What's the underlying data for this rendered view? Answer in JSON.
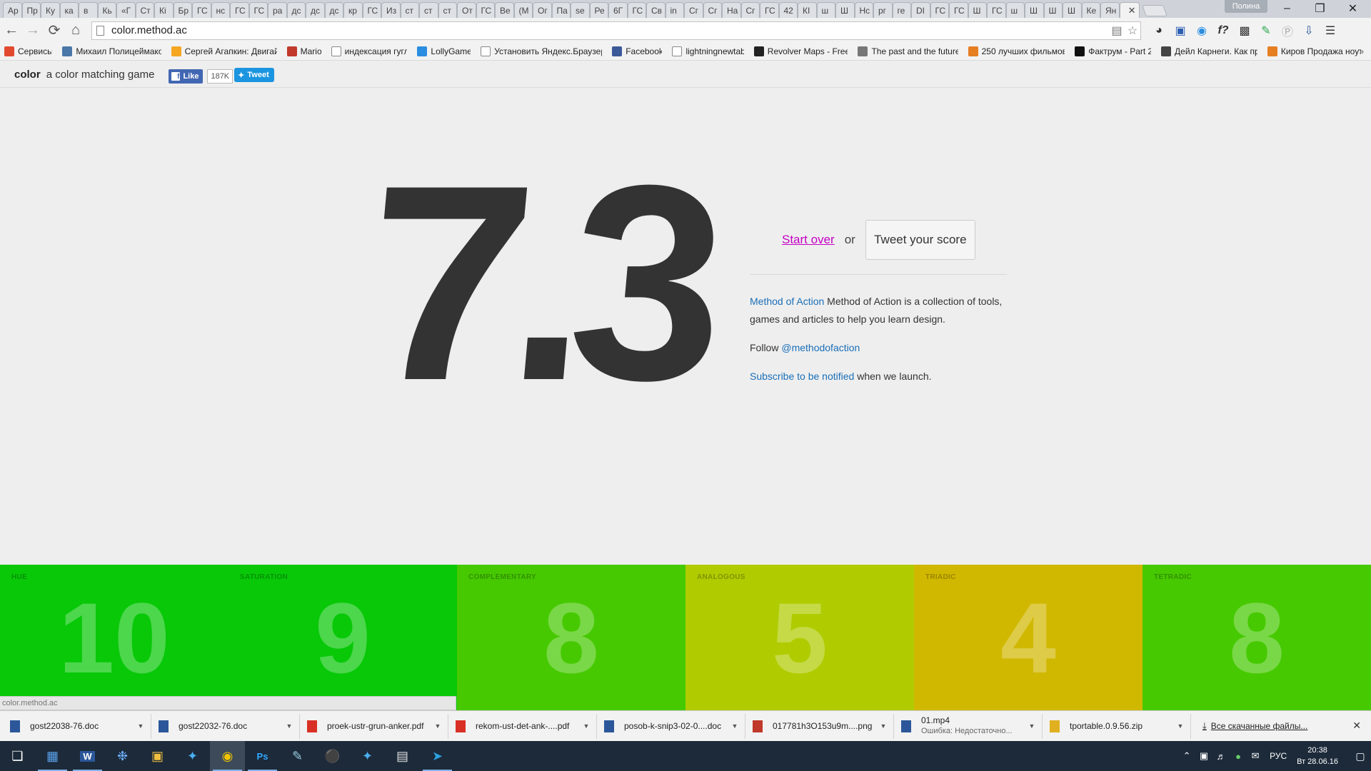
{
  "browser": {
    "tabs": [
      "Ар",
      "Пр",
      "Ку",
      "ка",
      "в",
      "Кь",
      "«Г",
      "Ст",
      "Кі",
      "Бр",
      "ГС",
      "нс",
      "ГС",
      "ГС",
      "ра",
      "дс",
      "дс",
      "дс",
      "кр",
      "ГС",
      "Из",
      "ст",
      "ст",
      "ст",
      "От",
      "ГС",
      "Ве",
      "(М",
      "Ог",
      "Па",
      "se",
      "Ре",
      "6Г",
      "ГС",
      "Св",
      "in",
      "Сг",
      "Сг",
      "На",
      "Сг",
      "ГС",
      "42",
      "КІ",
      "ш",
      "Ш",
      "Нс",
      "рг",
      "ге",
      "DI",
      "ГС",
      "ГС",
      "Ш",
      "ГС",
      "ш",
      "Ш",
      "Ш",
      "Ш",
      "Ке",
      "Ян"
    ],
    "user_badge": "Полина",
    "url": "color.method.ac",
    "bookmarks": [
      {
        "label": "Сервисы",
        "icon": "apps-icon",
        "color": "#e24a2f"
      },
      {
        "label": "Михаил Полицеймако",
        "icon": "vk-icon",
        "color": "#4a76a8"
      },
      {
        "label": "Сергей Агапкин: Двигай",
        "icon": "sun-icon",
        "color": "#f5a623"
      },
      {
        "label": "Mario",
        "icon": "mario-icon",
        "color": "#c0392b"
      },
      {
        "label": "индексация гугл",
        "icon": "page-icon",
        "color": "#ffffff"
      },
      {
        "label": "LollyGame",
        "icon": "lolly-icon",
        "color": "#2a8de0"
      },
      {
        "label": "Установить Яндекс.Браузер",
        "icon": "page-icon",
        "color": "#ffffff"
      },
      {
        "label": "Facebook",
        "icon": "facebook-icon",
        "color": "#3b5998"
      },
      {
        "label": "lightningnewtab",
        "icon": "page-icon",
        "color": "#ffffff"
      },
      {
        "label": "Revolver Maps - Free",
        "icon": "rm-icon",
        "color": "#222222"
      },
      {
        "label": "The past and the future",
        "icon": "fork-icon",
        "color": "#777777"
      },
      {
        "label": "250 лучших фильмов",
        "icon": "film-icon",
        "color": "#e67e22"
      },
      {
        "label": "Фактрум - Part 2",
        "icon": "factrum-icon",
        "color": "#111111"
      },
      {
        "label": "Дейл Карнеги. Как пр",
        "icon": "book-icon",
        "color": "#444444"
      },
      {
        "label": "Киров Продажа ноут",
        "icon": "avito-icon",
        "color": "#e67e22"
      }
    ]
  },
  "page": {
    "brand": "color",
    "tagline": "a color matching game",
    "fb_like": "Like",
    "fb_count": "187K",
    "tweet": "Tweet",
    "score": "7.3",
    "start_over": "Start over",
    "or": "or",
    "tweet_score": "Tweet your score",
    "moa_link": "Method of Action",
    "moa_text": " Method of Action is a collection of tools, games and articles to help you learn design.",
    "follow": "Follow ",
    "follow_handle": "@methodofaction",
    "subscribe_link": "Subscribe to be notified",
    "subscribe_text": " when we launch.",
    "tiles": [
      {
        "label": "HUE",
        "value": "10",
        "color": "#08c808"
      },
      {
        "label": "SATURATION",
        "value": "9",
        "color": "#08c808"
      },
      {
        "label": "COMPLEMENTARY",
        "value": "8",
        "color": "#46c900"
      },
      {
        "label": "ANALOGOUS",
        "value": "5",
        "color": "#b0cc00"
      },
      {
        "label": "TRIADIC",
        "value": "4",
        "color": "#d1b800"
      },
      {
        "label": "TETRADIC",
        "value": "8",
        "color": "#46c900"
      }
    ],
    "status_url": "color.method.ac"
  },
  "downloads": {
    "items": [
      {
        "name": "gost22038-76.doc",
        "sub": "",
        "icon": "word-doc-icon",
        "color": "#2b579a"
      },
      {
        "name": "gost22032-76.doc",
        "sub": "",
        "icon": "word-doc-icon",
        "color": "#2b579a"
      },
      {
        "name": "proek-ustr-grun-anker.pdf",
        "sub": "",
        "icon": "pdf-icon",
        "color": "#d93025"
      },
      {
        "name": "rekom-ust-det-ank-....pdf",
        "sub": "",
        "icon": "pdf-icon",
        "color": "#d93025"
      },
      {
        "name": "posob-k-snip3-02-0....doc",
        "sub": "",
        "icon": "word-doc-icon",
        "color": "#2b579a"
      },
      {
        "name": "017781h3O153u9m....png",
        "sub": "",
        "icon": "image-icon",
        "color": "#c0392b"
      },
      {
        "name": "01.mp4",
        "sub": "Ошибка: Недостаточно...",
        "icon": "video-icon",
        "color": "#2b579a"
      },
      {
        "name": "tportable.0.9.56.zip",
        "sub": "",
        "icon": "zip-icon",
        "color": "#e0b020"
      }
    ],
    "show_all": "Все скачанные файлы..."
  },
  "taskbar": {
    "lang": "РУС",
    "time": "20:38",
    "date": "Вт 28.06.16"
  }
}
